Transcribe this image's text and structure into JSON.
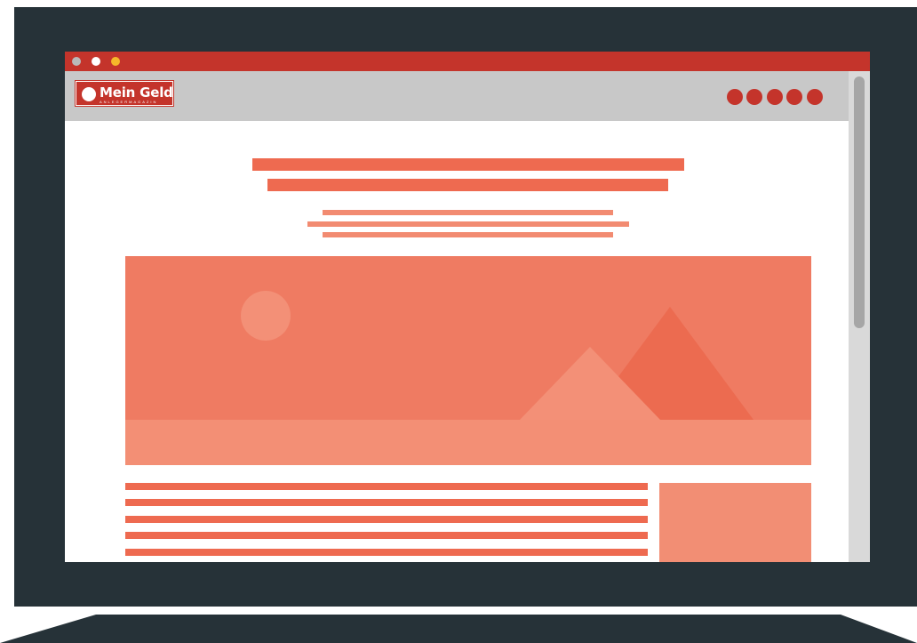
{
  "logo": {
    "title": "Mein Geld",
    "subtitle": "ANLEGERMAGAZIN"
  },
  "window_controls": [
    {
      "name": "close",
      "color": "#b9b9b9"
    },
    {
      "name": "minimize",
      "color": "#ffffff"
    },
    {
      "name": "maximize",
      "color": "#f6b72a"
    }
  ],
  "nav_items": [
    "nav-item-1",
    "nav-item-2",
    "nav-item-3",
    "nav-item-4",
    "nav-item-5"
  ],
  "colors": {
    "frame": "#263238",
    "titlebar": "#c4342b",
    "toolbar": "#c8c8c8",
    "accent": "#ee6a50",
    "accent_light": "#f28b71",
    "hero": "#ef7b62"
  },
  "scrollbar": {
    "position": 0
  }
}
